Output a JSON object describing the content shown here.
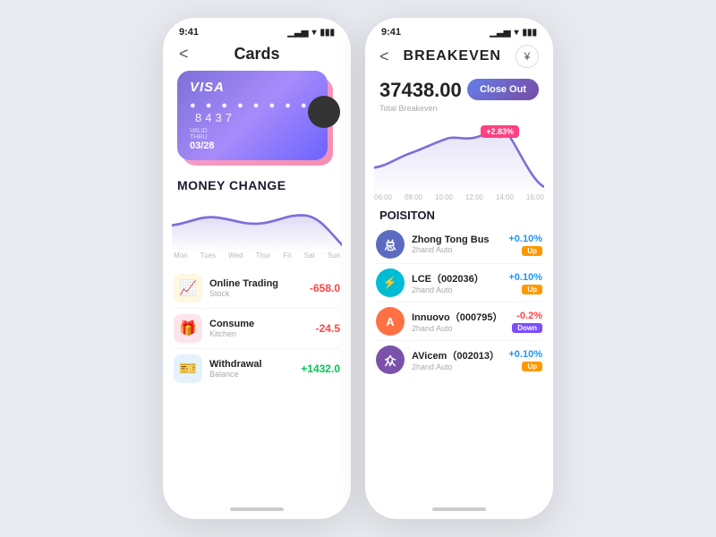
{
  "left": {
    "statusBar": {
      "time": "9:41"
    },
    "header": {
      "title": "Cards",
      "backLabel": "<"
    },
    "card": {
      "brand": "VISA",
      "dots": "● ● ● ● ● ● ● ●",
      "lastFour": "8437",
      "validThruLabel": "VALID\nTHRU",
      "validThruValue": "03/28"
    },
    "moneyChange": {
      "title": "MONEY CHANGE"
    },
    "dayLabels": [
      "Mon",
      "Tues",
      "Wed",
      "Thur",
      "Fri",
      "Sat",
      "Sun"
    ],
    "transactions": [
      {
        "name": "Online Trading",
        "sub": "Stock",
        "amount": "-658.0",
        "type": "neg",
        "icon": "📈"
      },
      {
        "name": "Consume",
        "sub": "Kitchen",
        "amount": "-24.5",
        "type": "neg2",
        "icon": "🎁"
      },
      {
        "name": "Withdrawal",
        "sub": "Balance",
        "amount": "+1432.0",
        "type": "pos",
        "icon": "🎫"
      }
    ]
  },
  "right": {
    "statusBar": {
      "time": "9:41"
    },
    "header": {
      "title": "BREAKEVEN",
      "backLabel": "<",
      "yenLabel": "¥"
    },
    "breakeven": {
      "value": "37438.00",
      "label": "Total Breakeven",
      "closeOutBtn": "Close Out"
    },
    "chart": {
      "badge": "+2.83%",
      "timeLabels": [
        "06:00",
        "08:00",
        "10:00",
        "12:00",
        "14:00",
        "16:00"
      ]
    },
    "position": {
      "title": "POISITON",
      "items": [
        {
          "name": "Zhong Tong Bus",
          "sub": "2hand   Auto",
          "change": "+0.10%",
          "badge": "Up",
          "color": "#5c6bc0",
          "initials": "总"
        },
        {
          "name": "LCE（002036）",
          "sub": "2hand   Auto",
          "change": "+0.10%",
          "badge": "Up",
          "color": "#00bcd4",
          "initials": "⚡"
        },
        {
          "name": "Innuovo（000795）",
          "sub": "2hand   Auto",
          "change": "-0.2%",
          "badge": "Down",
          "color": "#ff7043",
          "initials": "A"
        },
        {
          "name": "AVicem（002013）",
          "sub": "2hand   Auto",
          "change": "+0.10%",
          "badge": "Up",
          "color": "#7b52ab",
          "initials": "众"
        }
      ]
    }
  }
}
